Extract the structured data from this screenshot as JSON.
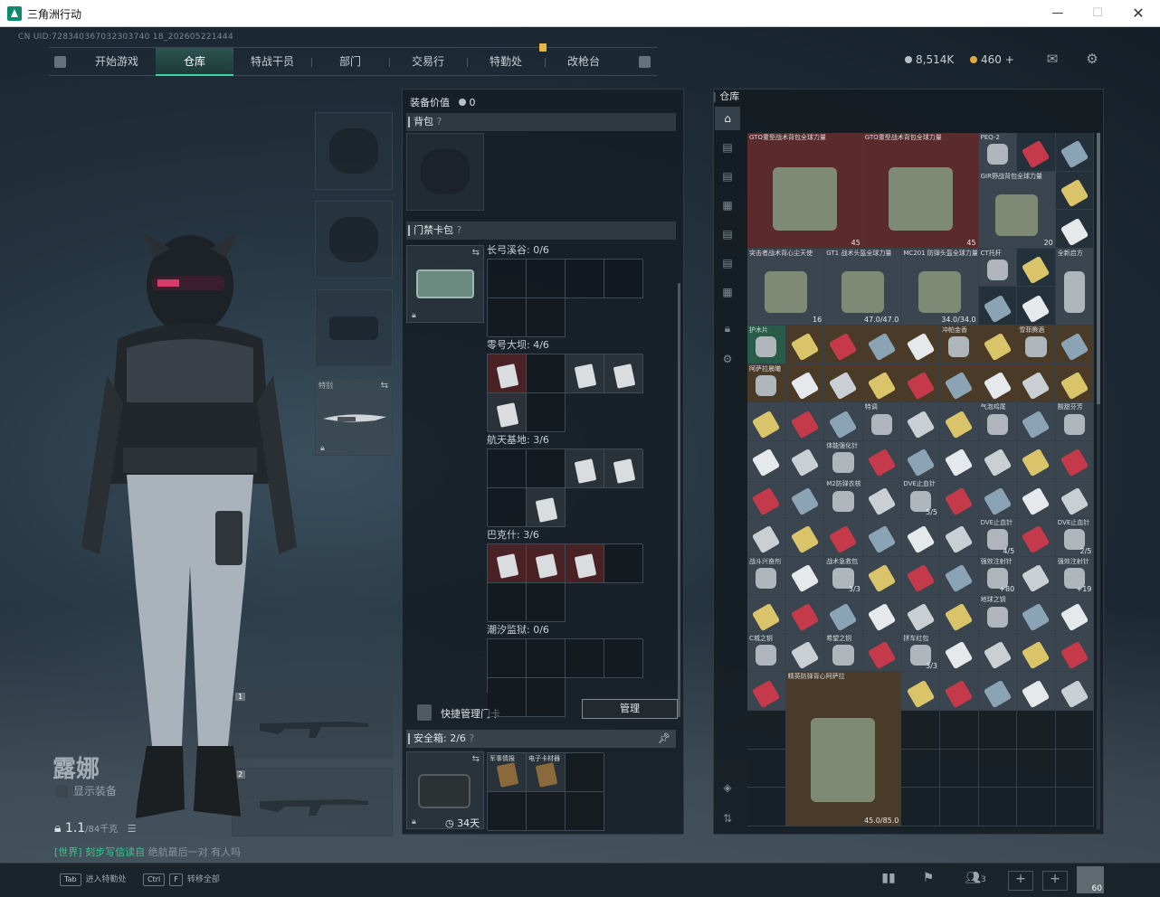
{
  "window": {
    "title": "三角洲行动"
  },
  "uid": "CN UID:728340367032303740 18_202605221444",
  "nav": {
    "tabs": [
      "开始游戏",
      "仓库",
      "特战干员",
      "部门",
      "交易行",
      "特勤处",
      "改枪台"
    ],
    "active_index": 1
  },
  "currency": {
    "money": "8,514K",
    "coins": "460",
    "plus": "+"
  },
  "character": {
    "name": "露娜",
    "show_equipment": "显示装备",
    "weight": "1.1",
    "weight_max": "/84千克"
  },
  "chat": {
    "channel": "[世界]",
    "user": "刻步写信读自",
    "message": "绝航最后一对 有人吗"
  },
  "bottom": {
    "hint1_key": "Tab",
    "hint1": "进入特勤处",
    "hint2_key1": "Ctrl",
    "hint2_key2": "F",
    "hint2": "转移全部",
    "friends": "3",
    "level": "60"
  },
  "loadout": {
    "melee_label": "特别",
    "slot1": "1",
    "slot2": "2"
  },
  "mid": {
    "equip_value_label": "装备价值",
    "equip_value": "0",
    "backpack_label": "背包",
    "keycard_label": "门禁卡包",
    "maps": [
      {
        "name": "长弓溪谷:",
        "count": "0/6"
      },
      {
        "name": "零号大坝:",
        "count": "4/6"
      },
      {
        "name": "航天基地:",
        "count": "3/6"
      },
      {
        "name": "巴克什:",
        "count": "3/6"
      },
      {
        "name": "潮汐监狱:",
        "count": "0/6"
      }
    ],
    "quick_manage": "快捷管理门卡",
    "manage_btn": "管理",
    "safe_label": "安全箱:",
    "safe_count": "2/6",
    "safe_days": "34天",
    "safe_items": [
      "军事情报",
      "电子卡材器"
    ]
  },
  "warehouse": {
    "title": "仓库",
    "items": [
      {
        "name": "GTO重型战术背包全球力量",
        "count": "45",
        "color": "#5a2a2c"
      },
      {
        "name": "GTO重型战术背包全球力量",
        "count": "45",
        "color": "#5a2a2c"
      },
      {
        "name": "PEQ-2",
        "count": "",
        "color": "#3a4550"
      },
      {
        "name": "GIR野战背包全球力量",
        "count": "20",
        "color": "#3a4550"
      },
      {
        "name": "突击者战术背心尘天使",
        "count": "16",
        "color": "#3a4550"
      },
      {
        "name": "GT1 战术头盔全球力量",
        "count": "47.0/47.0",
        "color": "#3a4550"
      },
      {
        "name": "MC201 防弹头盔全球力量",
        "count": "34.0/34.0",
        "color": "#3a4550"
      },
      {
        "name": "CT托杆",
        "count": "",
        "color": "#3a4550"
      },
      {
        "name": "全新启方",
        "count": "",
        "color": "#3a4550"
      },
      {
        "name": "护木片",
        "count": "",
        "color": "#2a5a48"
      },
      {
        "name": "冲帕金香",
        "count": "",
        "color": "#4a3a28"
      },
      {
        "name": "雪菲腾酒",
        "count": "",
        "color": "#4a3a28"
      },
      {
        "name": "阿萨拉晨曦",
        "count": "",
        "color": "#4a3a28"
      },
      {
        "name": "特调",
        "count": "",
        "color": "#3a4550"
      },
      {
        "name": "气泡鸡尾",
        "count": "",
        "color": "#3a4550"
      },
      {
        "name": "酸甜芬芳",
        "count": "",
        "color": "#3a4550"
      },
      {
        "name": "体能强化针",
        "count": "",
        "color": "#3a4550"
      },
      {
        "name": "M2防弹衣核",
        "count": "",
        "color": "#3a4550"
      },
      {
        "name": "DVE止血针",
        "count": "5/5",
        "color": "#3a4550"
      },
      {
        "name": "DVE止血针",
        "count": "4/5",
        "color": "#3a4550"
      },
      {
        "name": "DVE止血针",
        "count": "2/5",
        "color": "#3a4550"
      },
      {
        "name": "战斗兴奋剂",
        "count": "",
        "color": "#3a4550"
      },
      {
        "name": "战术急救包",
        "count": "3/3",
        "color": "#3a4550"
      },
      {
        "name": "强效注射针",
        "count": "+80",
        "color": "#3a4550"
      },
      {
        "name": "强效注射针",
        "count": "+19",
        "color": "#3a4550"
      },
      {
        "name": "地球之钥",
        "count": "",
        "color": "#3a4550"
      },
      {
        "name": "C城之钥",
        "count": "",
        "color": "#3a4550"
      },
      {
        "name": "希望之钥",
        "count": "",
        "color": "#3a4550"
      },
      {
        "name": "拼车红包",
        "count": "3/3",
        "color": "#3a4550"
      },
      {
        "name": "精英防弹背心阿萨拉",
        "count": "45.0/85.0",
        "color": "#4a3a28"
      }
    ]
  }
}
